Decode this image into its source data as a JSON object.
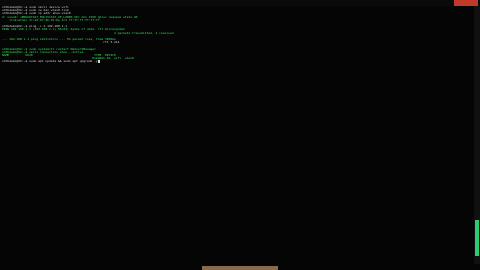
{
  "window": {
    "title": "",
    "close_label": "",
    "bottom_tab_label": ""
  },
  "terminal": {
    "lines": [
      {
        "cls": "white",
        "text": "uhtbdemo@tk:~$ sudo nmcli device wifi"
      },
      {
        "cls": "white",
        "text": "uhtbdemo@tk:~$ sudo iw dev wlan0 link"
      },
      {
        "cls": "white",
        "text": "uhtbdemo@tk:~$ sudo ip addr show wlan0"
      },
      {
        "cls": "green",
        "text": "2: wlan0: <BROADCAST,MULTICAST,UP,LOWER_UP> mtu 1500 qdisc noqueue state UP"
      },
      {
        "cls": "green",
        "text": "    link/ether 3c:a0:67:4b:91:0e brd ff:ff:ff:ff:ff:ff"
      },
      {
        "cls": "white",
        "text": ""
      },
      {
        "cls": "white",
        "text": "uhtbdemo@tk:~$ ping -c 4 192.168.1.1"
      },
      {
        "cls": "green",
        "text": "PING 192.168.1.1 (192.168.1.1) 56(84) bytes of data. rtt min/avg/max"
      },
      {
        "cls": "green",
        "text": "                                                              4 packets transmitted, 4 received"
      },
      {
        "cls": "white",
        "text": ""
      },
      {
        "cls": "green",
        "text": "--- 192.168.1.1 ping statistics --- 0% packet loss, time 3004ms"
      },
      {
        "cls": "white",
        "text": "                                                        rtt 3.214"
      },
      {
        "cls": "white",
        "text": ""
      },
      {
        "cls": "green",
        "text": "uhtbdemo@tk:~$ sudo systemctl restart NetworkManager"
      },
      {
        "cls": "green",
        "text": "uhtbdemo@tk:~$ nmcli connection show --active"
      },
      {
        "cls": "green",
        "text": "NAME         UUID                                  TYPE  DEVICE"
      },
      {
        "cls": "green",
        "text": "                                                  HomeNet-5G  wifi  wlan0"
      },
      {
        "cls": "white",
        "text": "uhtbdemo@tk:~$ sudo apt update && sudo apt upgrade -y"
      }
    ]
  }
}
